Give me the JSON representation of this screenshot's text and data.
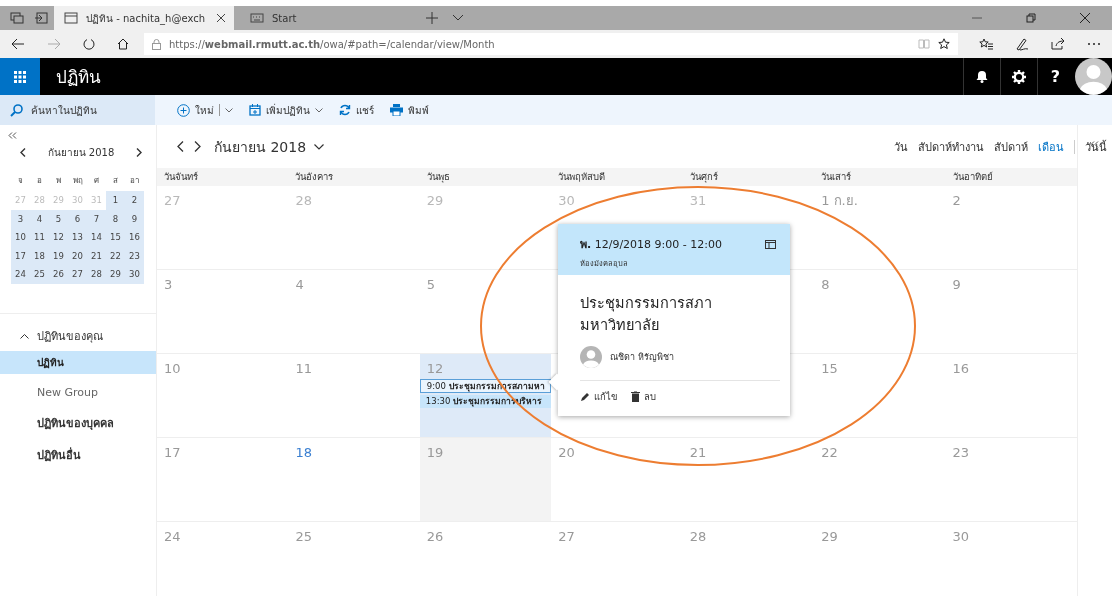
{
  "browser": {
    "tabs": [
      {
        "title": "ปฏิทิน - nachita_h@exch",
        "selected": true
      },
      {
        "title": "Start",
        "selected": false
      }
    ],
    "url": "https://**webmail.rmutt.ac.th**/owa/#path=/calendar/view/Month"
  },
  "app_bar": {
    "title": "ปฏิทิน",
    "help": "?"
  },
  "search": {
    "placeholder": "ค้นหาในปฏิทิน"
  },
  "toolbar": [
    {
      "label": "ใหม่",
      "kind": "new"
    },
    {
      "label": "เพิ่มปฏิทิน",
      "kind": "add"
    },
    {
      "label": "แชร์",
      "kind": "share"
    },
    {
      "label": "พิมพ์",
      "kind": "print"
    }
  ],
  "mini_calendar": {
    "month": "กันยายน 2018",
    "weekdays": [
      "จ",
      "อ",
      "พ",
      "พฤ",
      "ศ",
      "ส",
      "อา"
    ],
    "weeks": [
      [
        {
          "d": "27",
          "muted": true
        },
        {
          "d": "28",
          "muted": true
        },
        {
          "d": "29",
          "muted": true
        },
        {
          "d": "30",
          "muted": true
        },
        {
          "d": "31",
          "muted": true
        },
        {
          "d": "1",
          "muted": false
        },
        {
          "d": "2",
          "muted": false
        }
      ],
      [
        {
          "d": "3",
          "muted": false
        },
        {
          "d": "4",
          "muted": false
        },
        {
          "d": "5",
          "muted": false
        },
        {
          "d": "6",
          "muted": false
        },
        {
          "d": "7",
          "muted": false
        },
        {
          "d": "8",
          "muted": false
        },
        {
          "d": "9",
          "muted": false
        }
      ],
      [
        {
          "d": "10",
          "muted": false
        },
        {
          "d": "11",
          "muted": false
        },
        {
          "d": "12",
          "muted": false
        },
        {
          "d": "13",
          "muted": false
        },
        {
          "d": "14",
          "muted": false
        },
        {
          "d": "15",
          "muted": false
        },
        {
          "d": "16",
          "muted": false
        }
      ],
      [
        {
          "d": "17",
          "muted": false
        },
        {
          "d": "18",
          "muted": false
        },
        {
          "d": "19",
          "muted": false
        },
        {
          "d": "20",
          "muted": false
        },
        {
          "d": "21",
          "muted": false
        },
        {
          "d": "22",
          "muted": false
        },
        {
          "d": "23",
          "muted": false
        }
      ],
      [
        {
          "d": "24",
          "muted": false
        },
        {
          "d": "25",
          "muted": false
        },
        {
          "d": "26",
          "muted": false
        },
        {
          "d": "27",
          "muted": false
        },
        {
          "d": "28",
          "muted": false
        },
        {
          "d": "29",
          "muted": false
        },
        {
          "d": "30",
          "muted": false
        }
      ]
    ]
  },
  "sidebar": {
    "group": {
      "label": "ปฏิทินของคุณ",
      "expanded": true,
      "items": [
        {
          "label": "ปฏิทิน",
          "selected": true
        },
        {
          "label": "New Group",
          "selected": false
        }
      ]
    },
    "links": [
      "ปฏิทินของบุคคล",
      "ปฏิทินอื่น"
    ]
  },
  "calendar": {
    "month": "กันยายน 2018",
    "views": [
      {
        "label": "วัน",
        "selected": false
      },
      {
        "label": "สัปดาห์ทำงาน",
        "selected": false
      },
      {
        "label": "สัปดาห์",
        "selected": false
      },
      {
        "label": "เดือน",
        "selected": true
      }
    ],
    "today": "วันนี้",
    "weekdays": [
      "วันจันทร์",
      "วันอังคาร",
      "วันพุธ",
      "วันพฤหัสบดี",
      "วันศุกร์",
      "วันเสาร์",
      "วันอาทิตย์"
    ],
    "weeks": [
      [
        {
          "date": "27",
          "kind": "other-month",
          "selected": false
        },
        {
          "date": "28",
          "kind": "other-month",
          "selected": false
        },
        {
          "date": "29",
          "kind": "other-month",
          "selected": false
        },
        {
          "date": "30",
          "kind": "other-month",
          "selected": false
        },
        {
          "date": "31",
          "kind": "other-month",
          "selected": false
        },
        {
          "date": "1 ก.ย.",
          "kind": "day",
          "selected": false
        },
        {
          "date": "2",
          "kind": "day",
          "selected": false
        }
      ],
      [
        {
          "date": "3",
          "kind": "day",
          "selected": false
        },
        {
          "date": "4",
          "kind": "day",
          "selected": false
        },
        {
          "date": "5",
          "kind": "day",
          "selected": false
        },
        {
          "kind": "day"
        },
        {
          "kind": "day"
        },
        {
          "date": "8",
          "kind": "day",
          "selected": false
        },
        {
          "date": "9",
          "kind": "day",
          "selected": false
        }
      ],
      [
        {
          "date": "10",
          "kind": "day",
          "selected": false
        },
        {
          "date": "11",
          "kind": "day",
          "selected": false
        },
        {
          "date": "12",
          "kind": "day",
          "selected": true,
          "events": [
            {
              "time": "9:00",
              "title": "ประชุมกรรมการสภามหา",
              "selected": true
            },
            {
              "time": "13:30",
              "title": "ประชุมกรรมการบริหาร",
              "selected": false
            }
          ]
        },
        {
          "kind": "day"
        },
        {
          "kind": "day"
        },
        {
          "date": "15",
          "kind": "day",
          "selected": false
        },
        {
          "date": "16",
          "kind": "day",
          "selected": false
        }
      ],
      [
        {
          "date": "17",
          "kind": "day",
          "selected": false
        },
        {
          "date": "18",
          "kind": "today",
          "selected": false
        },
        {
          "date": "19",
          "kind": "hover",
          "selected": false
        },
        {
          "date": "20",
          "kind": "day",
          "selected": false
        },
        {
          "date": "21",
          "kind": "day",
          "selected": false
        },
        {
          "date": "22",
          "kind": "day",
          "selected": false
        },
        {
          "date": "23",
          "kind": "day",
          "selected": false
        }
      ],
      [
        {
          "date": "24",
          "kind": "day",
          "selected": false
        },
        {
          "date": "25",
          "kind": "day",
          "selected": false
        },
        {
          "date": "26",
          "kind": "day",
          "selected": false
        },
        {
          "date": "27",
          "kind": "day",
          "selected": false
        },
        {
          "date": "28",
          "kind": "day",
          "selected": false
        },
        {
          "date": "29",
          "kind": "day",
          "selected": false
        },
        {
          "date": "30",
          "kind": "day",
          "selected": false
        }
      ]
    ]
  },
  "popup": {
    "when": "**พ.** 12/9/2018 9:00 - 12:00",
    "location": "ห้องมังคลอุบล",
    "title": "ประชุมกรรมการสภามหาวิทยาลัย",
    "organizer": "ณชิดา หิรัญพิชา",
    "actions": [
      {
        "label": "แก้ไข",
        "kind": "edit"
      },
      {
        "label": "ลบ",
        "kind": "delete"
      }
    ]
  }
}
